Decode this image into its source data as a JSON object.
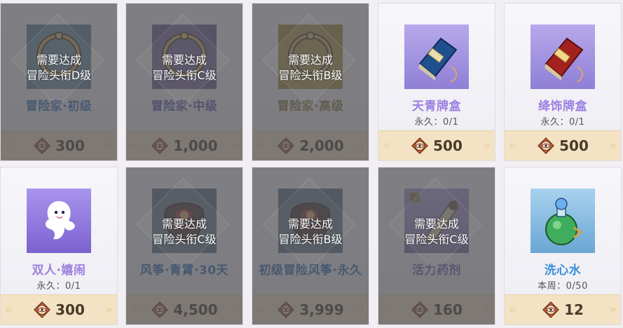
{
  "colors": {
    "title_purple": "#9b7fe0",
    "title_blue": "#3b80c8",
    "title_gold": "#a08a3a",
    "price_bg": "#f3e3c4",
    "mask": "#505054"
  },
  "items": [
    {
      "name": "冒险家·初级",
      "limit": "",
      "price": "300",
      "locked": true,
      "req1": "需要达成",
      "req2": "冒险头衔D级",
      "icon": "ring-icon",
      "frame": "#5a7e98",
      "title_color": "#2f70b8"
    },
    {
      "name": "冒险家·中级",
      "limit": "",
      "price": "1,000",
      "locked": true,
      "req1": "需要达成",
      "req2": "冒险头衔C级",
      "icon": "ring-icon",
      "frame": "#6a5a94",
      "title_color": "#5a58b0"
    },
    {
      "name": "冒险家·高级",
      "limit": "",
      "price": "2,000",
      "locked": true,
      "req1": "需要达成",
      "req2": "冒险头衔B级",
      "icon": "ring-icon",
      "frame": "#a08a3a",
      "title_color": "#8c7a36"
    },
    {
      "name": "天青牌盒",
      "limit": "永久：0/1",
      "price": "500",
      "locked": false,
      "req1": "",
      "req2": "",
      "icon": "blue-book-icon",
      "frame": "#9a88d8",
      "title_color": "#9b7fe0"
    },
    {
      "name": "绛饰牌盒",
      "limit": "永久：0/1",
      "price": "500",
      "locked": false,
      "req1": "",
      "req2": "",
      "icon": "red-book-icon",
      "frame": "#9a88d8",
      "title_color": "#9b7fe0"
    },
    {
      "name": "双人·嬉闹",
      "limit": "永久：0/1",
      "price": "300",
      "locked": false,
      "req1": "",
      "req2": "",
      "icon": "ghost-icon",
      "frame": "#8e76d6",
      "title_color": "#9b7fe0"
    },
    {
      "name": "风筝·青霄·30天",
      "limit": "",
      "price": "4,500",
      "locked": true,
      "req1": "需要达成",
      "req2": "冒险头衔C级",
      "icon": "kite-icon",
      "frame": "#5a6f86",
      "title_color": "#2f70b8"
    },
    {
      "name": "初级冒险风筝·永久",
      "limit": "",
      "price": "3,999",
      "locked": true,
      "req1": "需要达成",
      "req2": "冒险头衔B级",
      "icon": "kite-icon",
      "frame": "#5a6f86",
      "title_color": "#2f70b8"
    },
    {
      "name": "活力药剂",
      "limit": "",
      "price": "160",
      "locked": true,
      "req1": "需要达成",
      "req2": "冒险头衔C级",
      "icon": "scroll-icon",
      "frame": "#7a6aa6",
      "title_color": "#7a5ab8"
    },
    {
      "name": "洗心水",
      "limit": "本周：0/50",
      "price": "12",
      "locked": false,
      "req1": "",
      "req2": "",
      "icon": "potion-icon",
      "frame": "#7fb2d8",
      "title_color": "#3b8fd8"
    }
  ]
}
